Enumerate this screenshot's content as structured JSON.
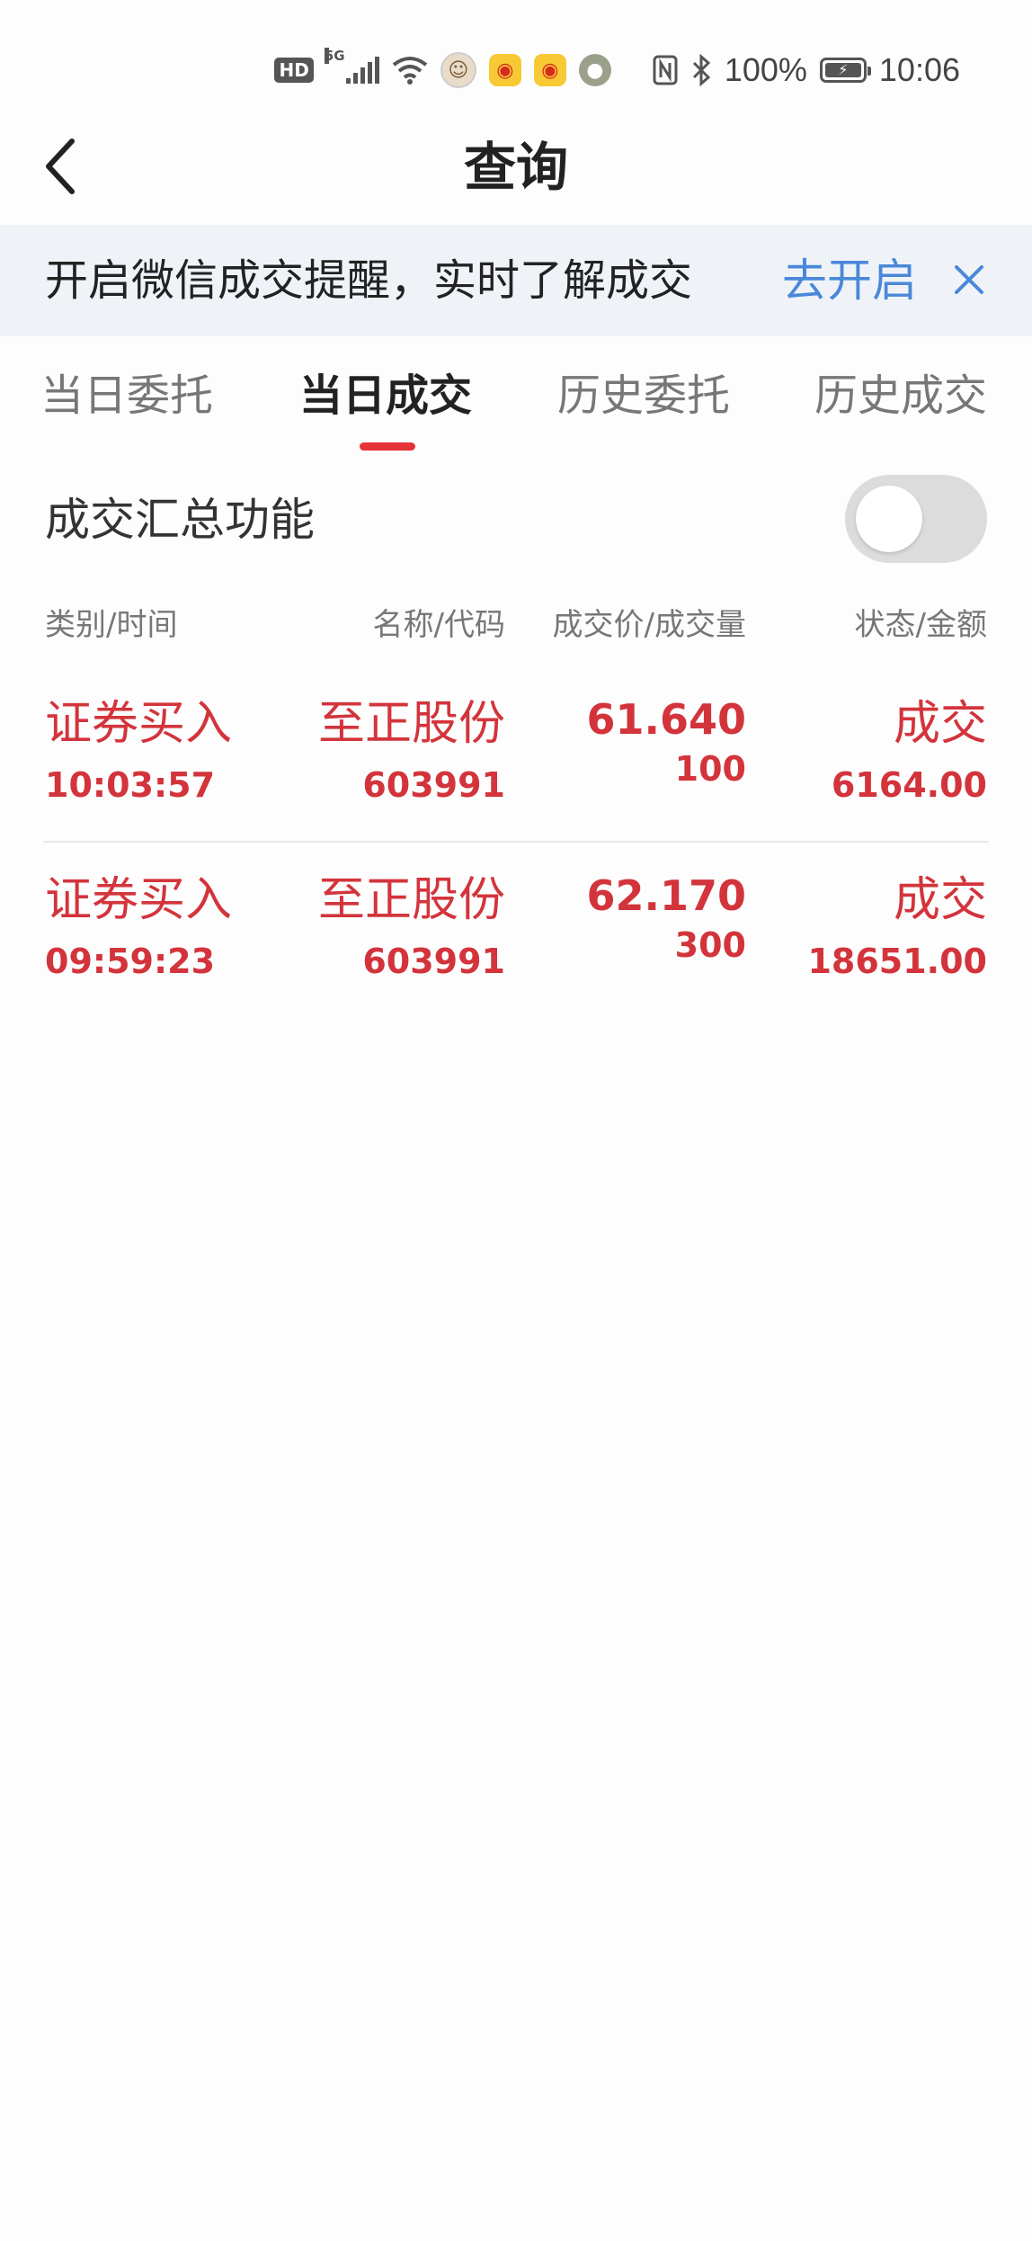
{
  "status_bar": {
    "hd": "HD",
    "network": "5G",
    "battery_percent": "100%",
    "time": "10:06"
  },
  "header": {
    "title": "查询"
  },
  "banner": {
    "text": "开启微信成交提醒，实时了解成交",
    "action": "去开启"
  },
  "tabs": [
    {
      "label": "当日委托",
      "active": false
    },
    {
      "label": "当日成交",
      "active": true
    },
    {
      "label": "历史委托",
      "active": false
    },
    {
      "label": "历史成交",
      "active": false
    }
  ],
  "summary": {
    "label": "成交汇总功能",
    "enabled": false
  },
  "columns": {
    "type_time": "类别/时间",
    "name_code": "名称/代码",
    "price_volume": "成交价/成交量",
    "status_amount": "状态/金额"
  },
  "rows": [
    {
      "type": "证券买入",
      "time": "10:03:57",
      "name": "至正股份",
      "code": "603991",
      "price": "61.640",
      "volume": "100",
      "status": "成交",
      "amount": "6164.00"
    },
    {
      "type": "证券买入",
      "time": "09:59:23",
      "name": "至正股份",
      "code": "603991",
      "price": "62.170",
      "volume": "300",
      "status": "成交",
      "amount": "18651.00"
    }
  ],
  "colors": {
    "accent_red": "#d3343c",
    "tab_indicator": "#e53238",
    "link_blue": "#4a88d9",
    "banner_bg": "#eff3f8"
  }
}
